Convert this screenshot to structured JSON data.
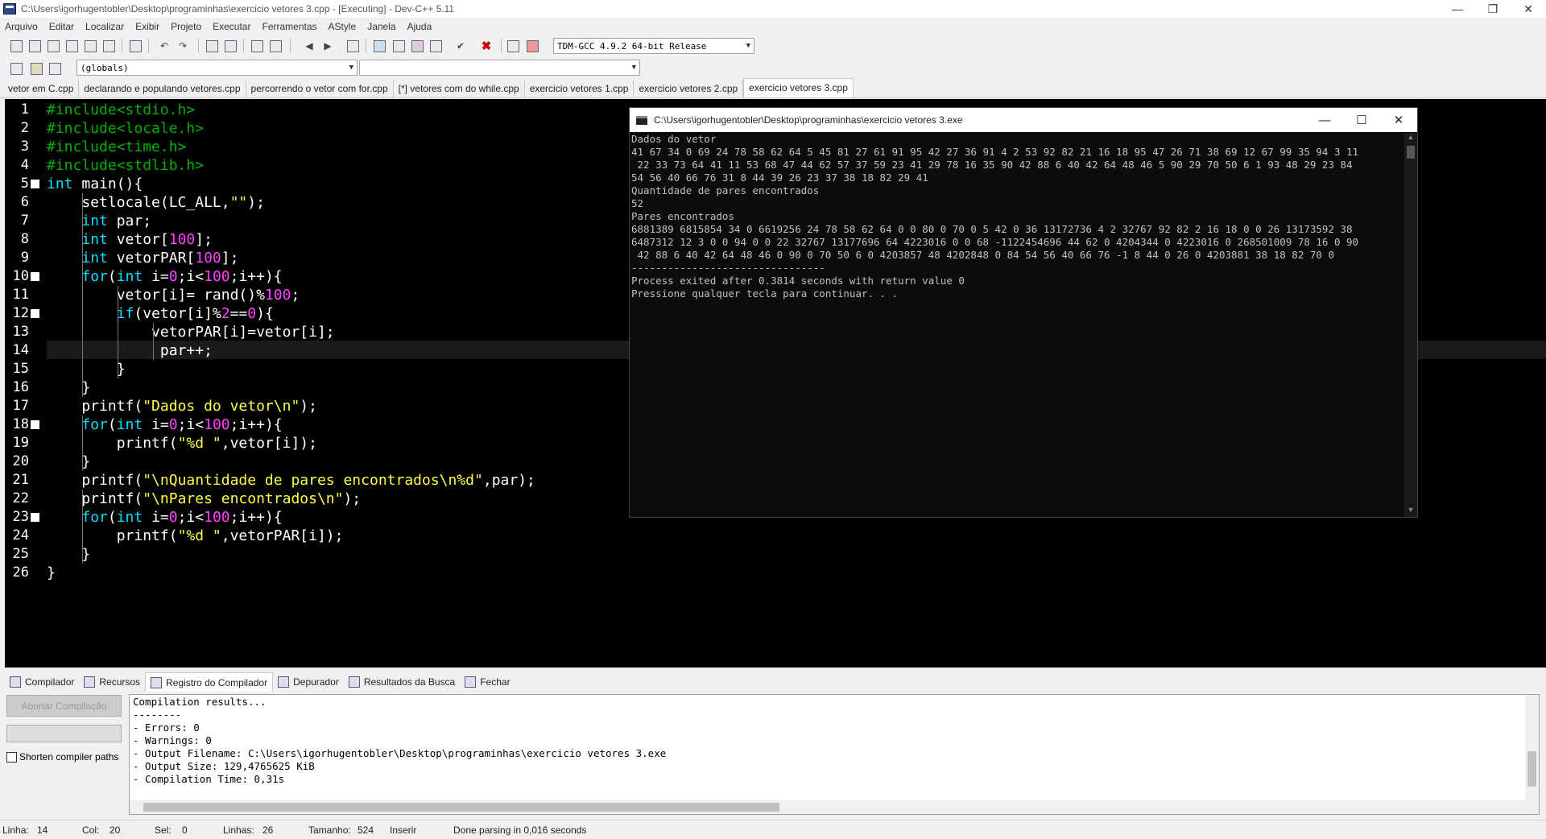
{
  "window": {
    "title": "C:\\Users\\igorhugentobler\\Desktop\\programinhas\\exercicio vetores 3.cpp - [Executing] - Dev-C++ 5.11",
    "minimize": "—",
    "maximize": "❐",
    "close": "✕"
  },
  "menu": [
    "Arquivo",
    "Editar",
    "Localizar",
    "Exibir",
    "Projeto",
    "Executar",
    "Ferramentas",
    "AStyle",
    "Janela",
    "Ajuda"
  ],
  "toolbar": {
    "compiler_select": "TDM-GCC 4.9.2 64-bit Release",
    "scope_select": "(globals)",
    "member_select": ""
  },
  "tabs": [
    {
      "label": "vetor em C.cpp"
    },
    {
      "label": "declarando e populando vetores.cpp"
    },
    {
      "label": "percorrendo o vetor com for.cpp"
    },
    {
      "label": "[*] vetores com do while.cpp"
    },
    {
      "label": "exercicio vetores 1.cpp"
    },
    {
      "label": "exercicio vetores 2.cpp"
    },
    {
      "label": "exercicio vetores 3.cpp"
    }
  ],
  "editor": {
    "line_numbers": [
      "1",
      "2",
      "3",
      "4",
      "5",
      "6",
      "7",
      "8",
      "9",
      "10",
      "11",
      "12",
      "13",
      "14",
      "15",
      "16",
      "17",
      "18",
      "19",
      "20",
      "21",
      "22",
      "23",
      "24",
      "25",
      "26"
    ],
    "code": [
      [
        [
          "pp",
          "#include<stdio.h>"
        ]
      ],
      [
        [
          "pp",
          "#include<locale.h>"
        ]
      ],
      [
        [
          "pp",
          "#include<time.h>"
        ]
      ],
      [
        [
          "pp",
          "#include<stdlib.h>"
        ]
      ],
      [
        [
          "k",
          "int"
        ],
        [
          "w",
          " main(){"
        ]
      ],
      [
        [
          "w",
          "    setlocale(LC_ALL,"
        ],
        [
          "s",
          "\"\""
        ],
        [
          "w",
          ");"
        ]
      ],
      [
        [
          "w",
          "    "
        ],
        [
          "k",
          "int"
        ],
        [
          "w",
          " par;"
        ]
      ],
      [
        [
          "w",
          "    "
        ],
        [
          "k",
          "int"
        ],
        [
          "w",
          " vetor["
        ],
        [
          "n",
          "100"
        ],
        [
          "w",
          "];"
        ]
      ],
      [
        [
          "w",
          "    "
        ],
        [
          "k",
          "int"
        ],
        [
          "w",
          " vetorPAR["
        ],
        [
          "n",
          "100"
        ],
        [
          "w",
          "];"
        ]
      ],
      [
        [
          "w",
          "    "
        ],
        [
          "k",
          "for"
        ],
        [
          "w",
          "("
        ],
        [
          "k",
          "int"
        ],
        [
          "w",
          " i="
        ],
        [
          "n",
          "0"
        ],
        [
          "w",
          ";i<"
        ],
        [
          "n",
          "100"
        ],
        [
          "w",
          ";i++){"
        ]
      ],
      [
        [
          "w",
          "        vetor[i]= rand()%"
        ],
        [
          "n",
          "100"
        ],
        [
          "w",
          ";"
        ]
      ],
      [
        [
          "w",
          "        "
        ],
        [
          "k",
          "if"
        ],
        [
          "w",
          "(vetor[i]%"
        ],
        [
          "n",
          "2"
        ],
        [
          "w",
          "=="
        ],
        [
          "n",
          "0"
        ],
        [
          "w",
          "){"
        ]
      ],
      [
        [
          "w",
          "            vetorPAR[i]=vetor[i];"
        ]
      ],
      [
        [
          "w",
          "             par++;"
        ]
      ],
      [
        [
          "w",
          "        }"
        ]
      ],
      [
        [
          "w",
          "    }"
        ]
      ],
      [
        [
          "w",
          "    printf("
        ],
        [
          "s",
          "\"Dados do vetor\\n\""
        ],
        [
          "w",
          ");"
        ]
      ],
      [
        [
          "w",
          "    "
        ],
        [
          "k",
          "for"
        ],
        [
          "w",
          "("
        ],
        [
          "k",
          "int"
        ],
        [
          "w",
          " i="
        ],
        [
          "n",
          "0"
        ],
        [
          "w",
          ";i<"
        ],
        [
          "n",
          "100"
        ],
        [
          "w",
          ";i++){"
        ]
      ],
      [
        [
          "w",
          "        printf("
        ],
        [
          "s",
          "\"%d \""
        ],
        [
          "w",
          ",vetor[i]);"
        ]
      ],
      [
        [
          "w",
          "    }"
        ]
      ],
      [
        [
          "w",
          "    printf("
        ],
        [
          "s",
          "\"\\nQuantidade de pares encontrados\\n%d\""
        ],
        [
          "w",
          ",par);"
        ]
      ],
      [
        [
          "w",
          "    printf("
        ],
        [
          "s",
          "\"\\nPares encontrados\\n\""
        ],
        [
          "w",
          ");"
        ]
      ],
      [
        [
          "w",
          "    "
        ],
        [
          "k",
          "for"
        ],
        [
          "w",
          "("
        ],
        [
          "k",
          "int"
        ],
        [
          "w",
          " i="
        ],
        [
          "n",
          "0"
        ],
        [
          "w",
          ";i<"
        ],
        [
          "n",
          "100"
        ],
        [
          "w",
          ";i++){"
        ]
      ],
      [
        [
          "w",
          "        printf("
        ],
        [
          "s",
          "\"%d \""
        ],
        [
          "w",
          ",vetorPAR[i]);"
        ]
      ],
      [
        [
          "w",
          "    }"
        ]
      ],
      [
        [
          "w",
          "}"
        ]
      ]
    ]
  },
  "console": {
    "title": "C:\\Users\\igorhugentobler\\Desktop\\programinhas\\exercicio vetores 3.exe",
    "lines": [
      "Dados do vetor",
      "41 67 34 0 69 24 78 58 62 64 5 45 81 27 61 91 95 42 27 36 91 4 2 53 92 82 21 16 18 95 47 26 71 38 69 12 67 99 35 94 3 11",
      " 22 33 73 64 41 11 53 68 47 44 62 57 37 59 23 41 29 78 16 35 90 42 88 6 40 42 64 48 46 5 90 29 70 50 6 1 93 48 29 23 84",
      "54 56 40 66 76 31 8 44 39 26 23 37 38 18 82 29 41",
      "Quantidade de pares encontrados",
      "52",
      "Pares encontrados",
      "6881389 6815854 34 0 6619256 24 78 58 62 64 0 0 80 0 70 0 5 42 0 36 13172736 4 2 32767 92 82 2 16 18 0 0 26 13173592 38",
      "6487312 12 3 0 0 94 0 0 22 32767 13177696 64 4223016 0 0 68 -1122454696 44 62 0 4204344 0 4223016 0 268501009 78 16 0 90",
      " 42 88 6 40 42 64 48 46 0 90 0 70 50 6 0 4203857 48 4202848 0 84 54 56 40 66 76 -1 8 44 0 26 0 4203881 38 18 82 70 0",
      "--------------------------------",
      "Process exited after 0.3814 seconds with return value 0",
      "Pressione qualquer tecla para continuar. . ."
    ]
  },
  "bottom_tabs": [
    "Compilador",
    "Recursos",
    "Registro do Compilador",
    "Depurador",
    "Resultados da Busca",
    "Fechar"
  ],
  "bottom_tabs_icons": [
    "compiler-icon",
    "resources-icon",
    "compile-log-icon",
    "debugger-icon",
    "search-results-icon",
    "close-panel-icon"
  ],
  "compiler_panel": {
    "abort_button": "Abortar Compilação",
    "shorten_paths_label": "Shorten compiler paths",
    "log": [
      "Compilation results...",
      "--------",
      "- Errors: 0",
      "- Warnings: 0",
      "- Output Filename: C:\\Users\\igorhugentobler\\Desktop\\programinhas\\exercicio vetores 3.exe",
      "- Output Size: 129,4765625 KiB",
      "- Compilation Time: 0,31s"
    ]
  },
  "status": {
    "line_label": "Linha:",
    "line_value": "14",
    "col_label": "Col:",
    "col_value": "20",
    "sel_label": "Sel:",
    "sel_value": "0",
    "lines_label": "Linhas:",
    "lines_value": "26",
    "size_label": "Tamanho:",
    "size_value": "524",
    "mode": "Inserir",
    "message": "Done parsing in 0,016 seconds"
  },
  "colors": {
    "keyword": "#00e0ff",
    "number": "#ff40ff",
    "string": "#ffff44",
    "preprocessor": "#00b000",
    "editor_bg": "#000000"
  }
}
